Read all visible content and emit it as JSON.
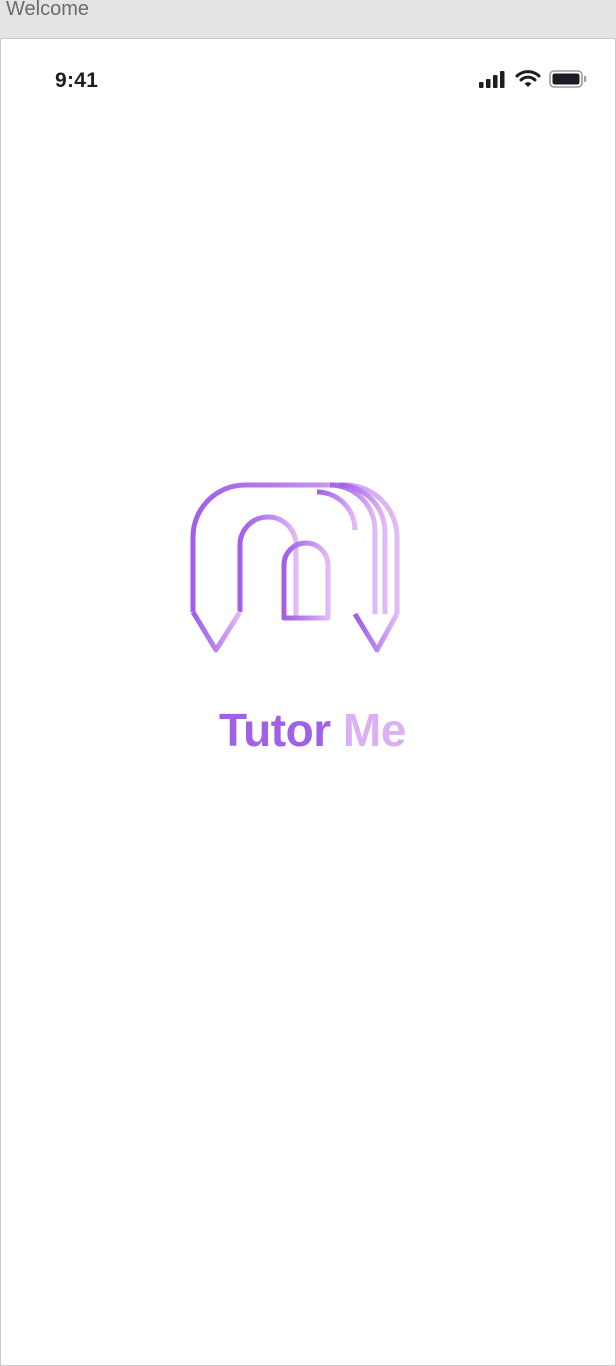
{
  "window": {
    "title": "Welcome"
  },
  "status_bar": {
    "time": "9:41",
    "icons": [
      "cellular-signal-icon",
      "wifi-icon",
      "battery-icon"
    ]
  },
  "brand": {
    "word1": "Tutor",
    "word2": "Me",
    "logo_icon": "pencil-arch-logo",
    "colors": {
      "primary": "#a061e6",
      "light": "#dcb0f4",
      "status_text": "#1c1c24"
    }
  }
}
